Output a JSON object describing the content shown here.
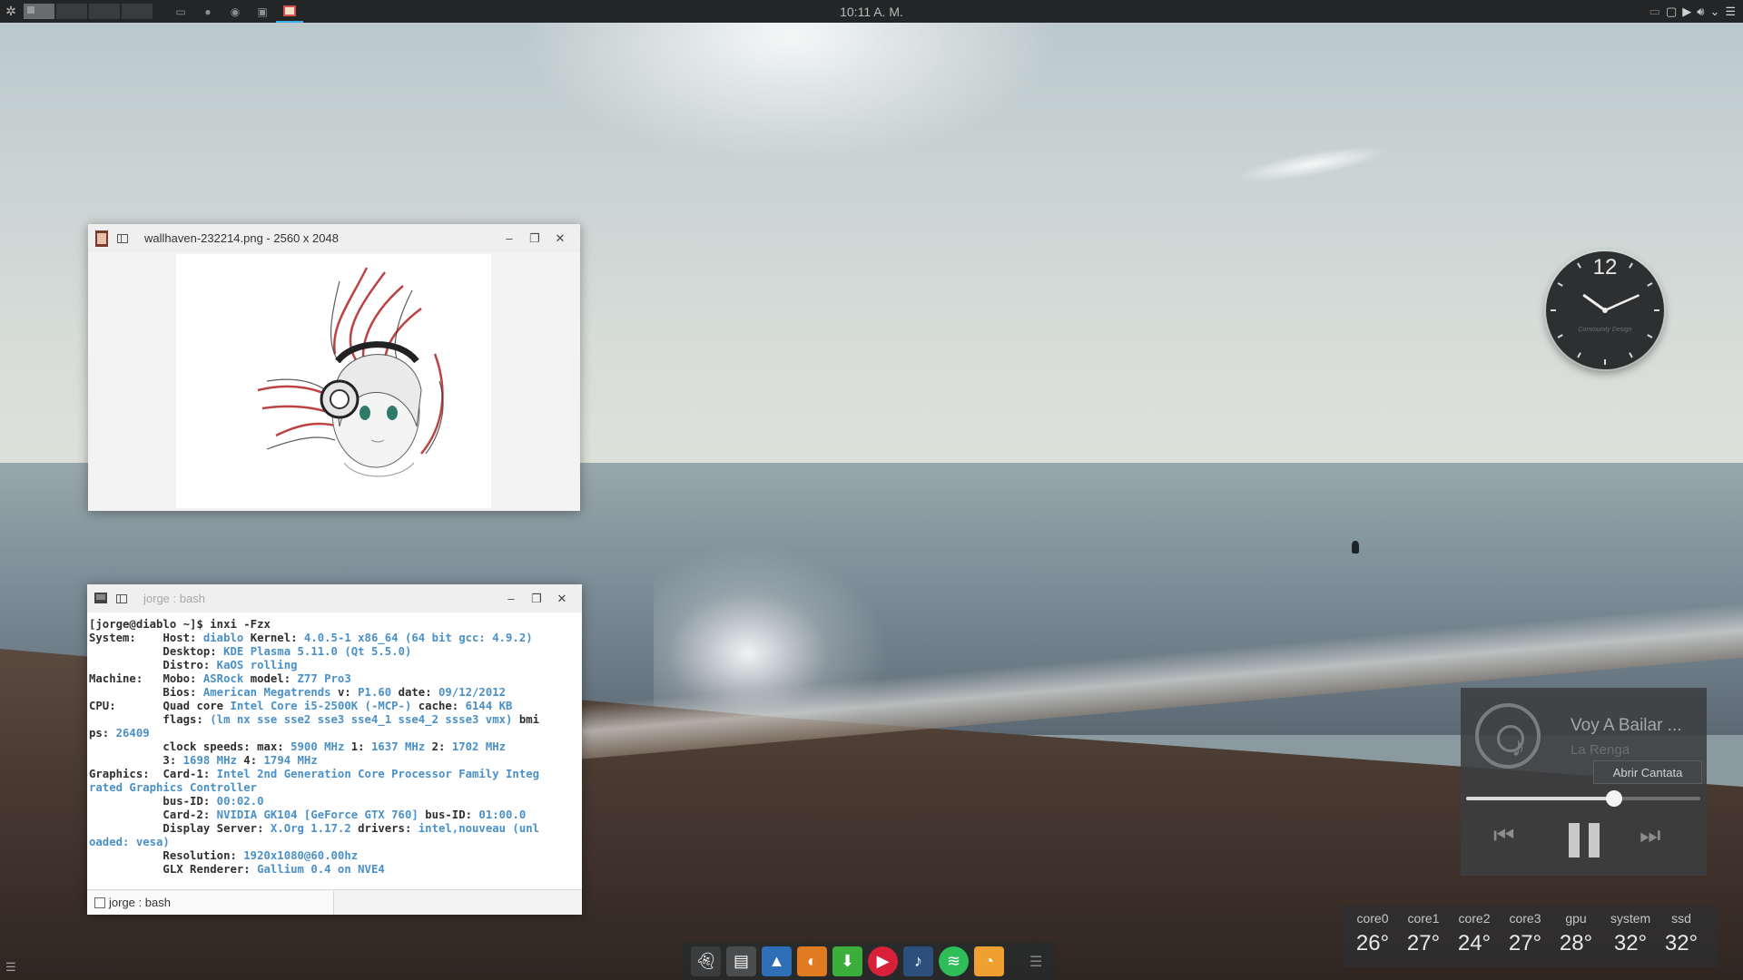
{
  "top_panel": {
    "clock": "10:11 A. M."
  },
  "image_viewer": {
    "title": "wallhaven-232214.png  - 2560 x 2048"
  },
  "terminal": {
    "title": "jorge : bash",
    "tab_label": "jorge : bash",
    "lines": [
      [
        {
          "t": "[jorge@diablo ~]$ inxi -Fzx",
          "c": "p"
        }
      ],
      [
        {
          "t": "System:    ",
          "c": "p"
        },
        {
          "t": "Host: ",
          "c": "p"
        },
        {
          "t": "diablo ",
          "c": "v"
        },
        {
          "t": "Kernel: ",
          "c": "p"
        },
        {
          "t": "4.0.5-1 x86_64 (64 bit gcc: 4.9.2)",
          "c": "v"
        }
      ],
      [
        {
          "t": "           Desktop: ",
          "c": "p"
        },
        {
          "t": "KDE Plasma 5.11.0 (Qt 5.5.0)",
          "c": "v"
        }
      ],
      [
        {
          "t": "           Distro: ",
          "c": "p"
        },
        {
          "t": "KaOS rolling",
          "c": "v"
        }
      ],
      [
        {
          "t": "Machine:   ",
          "c": "p"
        },
        {
          "t": "Mobo: ",
          "c": "p"
        },
        {
          "t": "ASRock ",
          "c": "v"
        },
        {
          "t": "model: ",
          "c": "p"
        },
        {
          "t": "Z77 Pro3",
          "c": "v"
        }
      ],
      [
        {
          "t": "           Bios: ",
          "c": "p"
        },
        {
          "t": "American Megatrends ",
          "c": "v"
        },
        {
          "t": "v: ",
          "c": "p"
        },
        {
          "t": "P1.60 ",
          "c": "v"
        },
        {
          "t": "date: ",
          "c": "p"
        },
        {
          "t": "09/12/2012",
          "c": "v"
        }
      ],
      [
        {
          "t": "CPU:       ",
          "c": "p"
        },
        {
          "t": "Quad core ",
          "c": "p"
        },
        {
          "t": "Intel Core i5-2500K (-MCP-) ",
          "c": "v"
        },
        {
          "t": "cache: ",
          "c": "p"
        },
        {
          "t": "6144 KB",
          "c": "v"
        }
      ],
      [
        {
          "t": "           flags: ",
          "c": "p"
        },
        {
          "t": "(lm nx sse sse2 sse3 sse4_1 sse4_2 ssse3 vmx) ",
          "c": "v"
        },
        {
          "t": "bmi",
          "c": "p"
        }
      ],
      [
        {
          "t": "ps: ",
          "c": "p"
        },
        {
          "t": "26409",
          "c": "v"
        }
      ],
      [
        {
          "t": "           clock speeds: ",
          "c": "p"
        },
        {
          "t": "max: ",
          "c": "p"
        },
        {
          "t": "5900 MHz ",
          "c": "v"
        },
        {
          "t": "1: ",
          "c": "p"
        },
        {
          "t": "1637 MHz ",
          "c": "v"
        },
        {
          "t": "2: ",
          "c": "p"
        },
        {
          "t": "1702 MHz",
          "c": "v"
        }
      ],
      [
        {
          "t": "           3: ",
          "c": "p"
        },
        {
          "t": "1698 MHz ",
          "c": "v"
        },
        {
          "t": "4: ",
          "c": "p"
        },
        {
          "t": "1794 MHz",
          "c": "v"
        }
      ],
      [
        {
          "t": "Graphics:  ",
          "c": "p"
        },
        {
          "t": "Card-1: ",
          "c": "p"
        },
        {
          "t": "Intel 2nd Generation Core Processor Family Integ",
          "c": "v"
        }
      ],
      [
        {
          "t": "rated Graphics Controller",
          "c": "v"
        }
      ],
      [
        {
          "t": "           bus-ID: ",
          "c": "p"
        },
        {
          "t": "00:02.0",
          "c": "v"
        }
      ],
      [
        {
          "t": "           Card-2: ",
          "c": "p"
        },
        {
          "t": "NVIDIA GK104 [GeForce GTX 760] ",
          "c": "v"
        },
        {
          "t": "bus-ID: ",
          "c": "p"
        },
        {
          "t": "01:00.0",
          "c": "v"
        }
      ],
      [
        {
          "t": "           Display Server: ",
          "c": "p"
        },
        {
          "t": "X.Org 1.17.2 ",
          "c": "v"
        },
        {
          "t": "drivers: ",
          "c": "p"
        },
        {
          "t": "intel,nouveau (unl",
          "c": "v"
        }
      ],
      [
        {
          "t": "oaded: vesa)",
          "c": "v"
        }
      ],
      [
        {
          "t": "           Resolution: ",
          "c": "p"
        },
        {
          "t": "1920x1080@60.00hz",
          "c": "v"
        }
      ],
      [
        {
          "t": "           GLX Renderer: ",
          "c": "p"
        },
        {
          "t": "Gallium 0.4 on NVE4",
          "c": "v"
        }
      ]
    ]
  },
  "analog_clock": {
    "hour_label": "12",
    "hour": 10,
    "minute": 11,
    "caption": "Community Design"
  },
  "media_player": {
    "title": "Voy A Bailar ...",
    "artist": "La Renga",
    "open_button": "Abrir Cantata",
    "progress": 0.63,
    "prev_icon": "skip-previous-icon",
    "next_icon": "skip-next-icon"
  },
  "sensors": [
    {
      "label": "core0",
      "value": "26°"
    },
    {
      "label": "core1",
      "value": "27°"
    },
    {
      "label": "core2",
      "value": "24°"
    },
    {
      "label": "core3",
      "value": "27°"
    },
    {
      "label": "gpu",
      "value": "28°"
    },
    {
      "label": "system",
      "value": "32°"
    },
    {
      "label": "ssd",
      "value": "32°"
    }
  ],
  "dock": {
    "apps": [
      {
        "name": "ghost-app-icon",
        "bg": "#3a3c3e"
      },
      {
        "name": "terminal-app-icon",
        "bg": "#4a4c4e"
      },
      {
        "name": "file-manager-app-icon",
        "bg": "#2f6fb8"
      },
      {
        "name": "firefox-app-icon",
        "bg": "#e07a20"
      },
      {
        "name": "download-manager-app-icon",
        "bg": "#3cae3c"
      },
      {
        "name": "media-player-app-icon",
        "bg": "#d8203a"
      },
      {
        "name": "cantata-app-icon",
        "bg": "#2c4f7c"
      },
      {
        "name": "spotify-app-icon",
        "bg": "#2ebd59"
      },
      {
        "name": "image-viewer-app-icon",
        "bg": "#f0a030"
      }
    ]
  }
}
